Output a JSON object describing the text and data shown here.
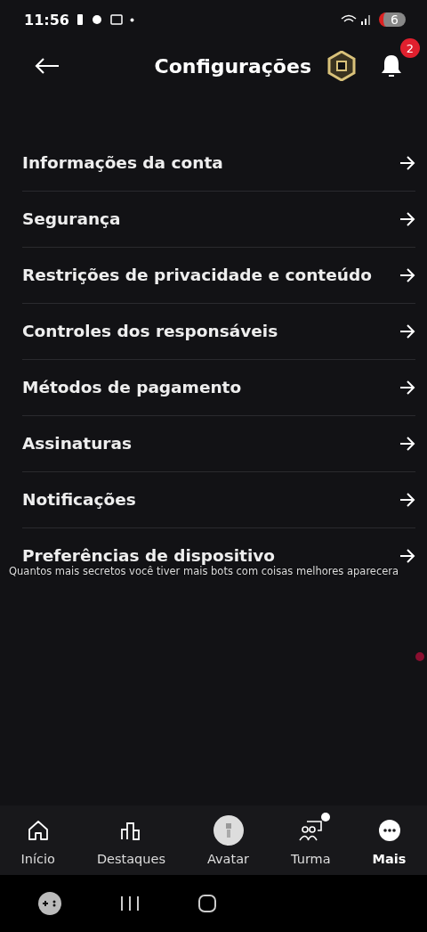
{
  "status_bar": {
    "time": "11:56",
    "battery": "6"
  },
  "header": {
    "title": "Configurações",
    "notification_count": "2"
  },
  "settings": [
    {
      "label": "Informações da conta"
    },
    {
      "label": "Segurança"
    },
    {
      "label": "Restrições de privacidade e conteúdo"
    },
    {
      "label": "Controles dos responsáveis"
    },
    {
      "label": "Métodos de pagamento"
    },
    {
      "label": "Assinaturas"
    },
    {
      "label": "Notificações"
    },
    {
      "label": "Preferências de dispositivo"
    }
  ],
  "caption": "Quantos mais secretos você tiver mais bots com coisas melhores aparecera",
  "bottom_nav": [
    {
      "kind": "home",
      "label": "Início",
      "selected": false,
      "dot": false
    },
    {
      "kind": "charts",
      "label": "Destaques",
      "selected": false,
      "dot": false
    },
    {
      "kind": "avatar",
      "label": "Avatar",
      "selected": false,
      "dot": false
    },
    {
      "kind": "group",
      "label": "Turma",
      "selected": false,
      "dot": true
    },
    {
      "kind": "more",
      "label": "Mais",
      "selected": true,
      "dot": false
    }
  ]
}
